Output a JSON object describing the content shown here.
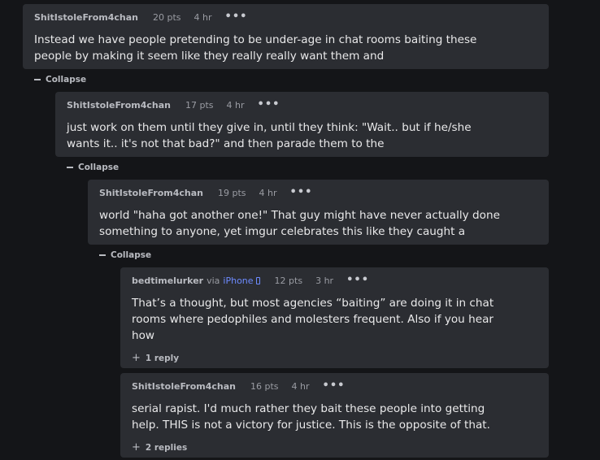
{
  "collapse_label": "Collapse",
  "comments": [
    {
      "author": "ShitIstoleFrom4chan",
      "points": "20 pts",
      "time": "4 hr",
      "menu": "•••",
      "text": "Instead we have people pretending to be under-age in chat rooms baiting these people by making it seem like they really really want them and"
    },
    {
      "author": "ShitIstoleFrom4chan",
      "points": "17 pts",
      "time": "4 hr",
      "menu": "•••",
      "text": "just work on them until they give in, until they think: \"Wait.. but if he/she wants it.. it's not that bad?\" and then parade them to the"
    },
    {
      "author": "ShitIstoleFrom4chan",
      "points": "19 pts",
      "time": "4 hr",
      "menu": "•••",
      "text": "world \"haha got another one!\" That guy might have never actually done something to anyone, yet imgur celebrates this like they caught a"
    },
    {
      "author": "bedtimelurker",
      "via": "via",
      "device": "iPhone",
      "device_icon": "phone-icon",
      "points": "12 pts",
      "time": "3 hr",
      "menu": "•••",
      "text": "That’s a thought, but most agencies “baiting” are doing it in chat rooms where pedophiles and molesters frequent. Also if you hear how",
      "replies": "1 reply"
    },
    {
      "author": "ShitIstoleFrom4chan",
      "points": "16 pts",
      "time": "4 hr",
      "menu": "•••",
      "text": "serial rapist. I'd much rather they bait these people into getting help. THIS is not a victory for justice. This is the opposite of that.",
      "replies": "2 replies"
    }
  ]
}
